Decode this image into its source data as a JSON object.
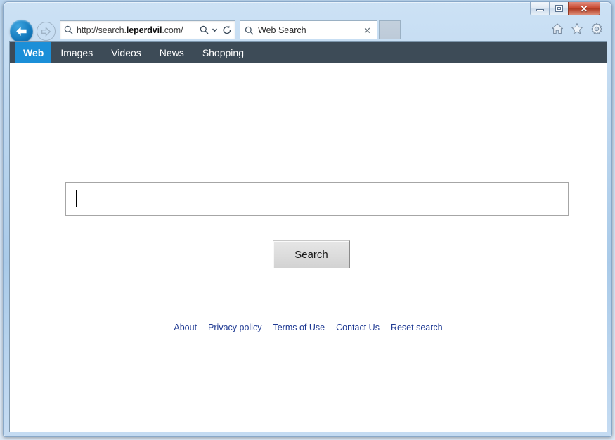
{
  "window": {
    "controls": {
      "minimize_label": "Minimize",
      "maximize_label": "Restore",
      "close_label": "✕"
    }
  },
  "browser": {
    "back_label": "Back",
    "forward_label": "Forward",
    "address": {
      "url_prefix": "http://search.",
      "url_domain": "leperdvil",
      "url_suffix": ".com/",
      "full_url": "http://search.leperdvil.com/",
      "search_icon": "search-icon",
      "dropdown_icon": "chevron-down-icon",
      "refresh_icon": "refresh-icon"
    },
    "tab": {
      "title": "Web Search",
      "favicon": "search-icon",
      "close_label": "✕"
    },
    "new_tab_label": "",
    "tools": [
      {
        "name": "home-icon",
        "label": "Home"
      },
      {
        "name": "favorites-icon",
        "label": "Favorites"
      },
      {
        "name": "gear-icon",
        "label": "Tools"
      }
    ]
  },
  "site": {
    "nav": [
      {
        "label": "Web",
        "active": true
      },
      {
        "label": "Images",
        "active": false
      },
      {
        "label": "Videos",
        "active": false
      },
      {
        "label": "News",
        "active": false
      },
      {
        "label": "Shopping",
        "active": false
      }
    ],
    "search": {
      "value": "",
      "placeholder": "",
      "button_label": "Search"
    },
    "footer_links": [
      {
        "label": "About"
      },
      {
        "label": "Privacy policy"
      },
      {
        "label": "Terms of Use"
      },
      {
        "label": "Contact Us"
      },
      {
        "label": "Reset search"
      }
    ]
  },
  "colors": {
    "nav_background": "#3d4b57",
    "nav_active": "#1b8fd8",
    "link": "#1f3a93",
    "close_button": "#c94a32",
    "back_button": "#1177bb"
  }
}
